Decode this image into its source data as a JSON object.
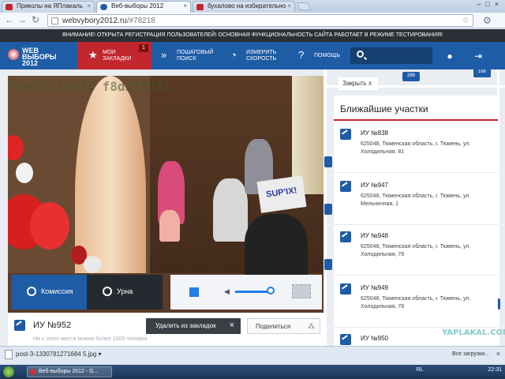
{
  "tabs": [
    {
      "label": "Приколы на ЯПлакаль",
      "active": false
    },
    {
      "label": "Веб-выборы 2012",
      "active": true
    },
    {
      "label": "бухалово на избирательно",
      "active": false
    }
  ],
  "address": {
    "host": "webvybory2012.ru",
    "path": "/#78218"
  },
  "banner": "ВНИМАНИЕ! ОТКРЫТА РЕГИСТРАЦИЯ ПОЛЬЗОВАТЕЛЕЙ! ОСНОВНАЯ ФУНКЦИОНАЛЬНОСТЬ САЙТА РАБОТАЕТ В РЕЖИМЕ ТЕСТИРОВАНИЯ!",
  "logo": {
    "line1": "WEB",
    "line2": "ВЫБОРЫ",
    "line3": "2012"
  },
  "nav": {
    "favorites": {
      "line1": "МОИ",
      "line2": "ЗАКЛАДКИ",
      "badge": "1"
    },
    "stepsearch": {
      "line1": "ПОШАГОВЫЙ",
      "line2": "ПОИСК"
    },
    "speed": {
      "line1": "ИЗМЕРИТЬ",
      "line2": "СКОРОСТЬ"
    },
    "help": "ПОМОЩЬ"
  },
  "video": {
    "overlay_hash": "0def1c1d578 f8d2f7351",
    "sign_text": "SUP'IX!"
  },
  "controls": {
    "commission": "Комиссия",
    "urn": "Урна"
  },
  "map": {
    "close_label": "Закрыть x",
    "markers": [
      "286",
      "166"
    ]
  },
  "station": {
    "title": "ИУ №952",
    "remove_bookmark": "Удалить из закладок",
    "share": "Поделиться",
    "blurred_note": "Ни с этого места можно более 1000 человек"
  },
  "panel": {
    "title": "Ближайшие участки",
    "items": [
      {
        "name": "ИУ №838",
        "address": "625048, Тюменская область, г. Тюмень, ул. Холодильная, 81"
      },
      {
        "name": "ИУ №947",
        "address": "625048, Тюменская область, г. Тюмень, ул. Мельничная, 1"
      },
      {
        "name": "ИУ №948",
        "address": "625048, Тюменская область, г. Тюмень, ул. Холодильная, 78"
      },
      {
        "name": "ИУ №949",
        "address": "625048, Тюменская область, г. Тюмень, ул. Холодильная, 78"
      },
      {
        "name": "ИУ №950",
        "address": ""
      }
    ]
  },
  "watermark": "YAPLAKAL.COM",
  "download": {
    "file": "post-3-1330781271684 5.jpg",
    "show_all": "Все загрузки..."
  },
  "taskbar": {
    "app": "Веб-выборы 2012 - G...",
    "lang": "RL",
    "clock": "22:31"
  }
}
